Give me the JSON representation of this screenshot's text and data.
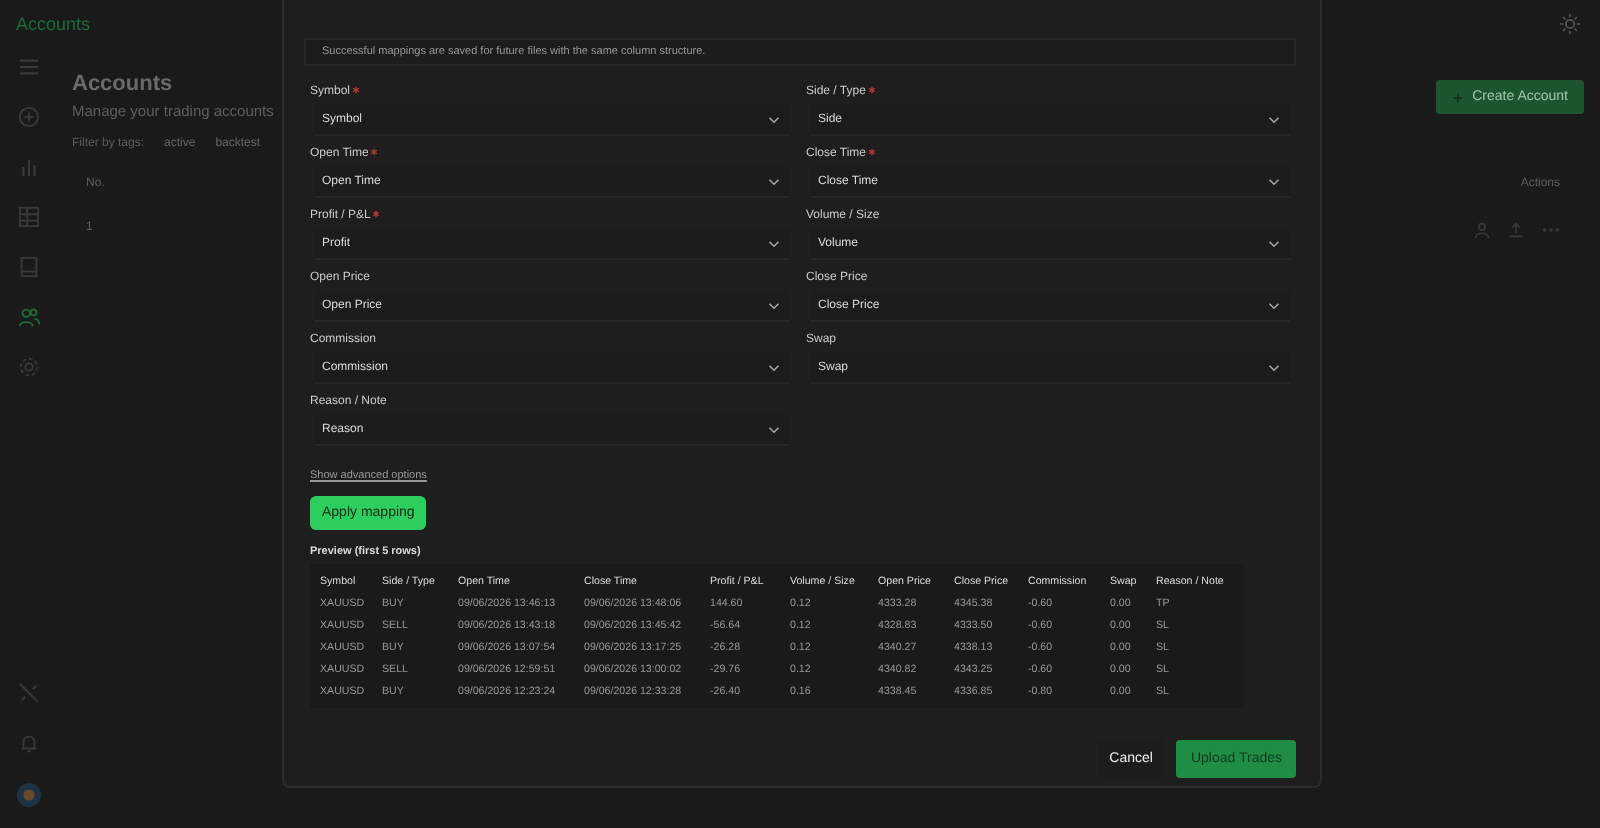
{
  "app": {
    "title": "Accounts"
  },
  "sidebar": {
    "items": [
      {
        "kind": "menu",
        "selected": false
      },
      {
        "kind": "add",
        "selected": false
      },
      {
        "kind": "chart",
        "selected": false
      },
      {
        "kind": "table",
        "selected": false
      },
      {
        "kind": "journal",
        "selected": false
      },
      {
        "kind": "accounts",
        "selected": true
      },
      {
        "kind": "settings",
        "selected": false
      }
    ],
    "bottom": [
      {
        "kind": "plug"
      },
      {
        "kind": "bell"
      },
      {
        "kind": "avatar"
      }
    ]
  },
  "page": {
    "title": "Accounts",
    "subtitle": "Manage your trading accounts",
    "filter_label": "Filter by tags:",
    "tags": [
      "active",
      "backtest"
    ],
    "create_button": "Create Account",
    "columns": [
      "No.",
      "Actions"
    ],
    "rows": [
      {
        "no": "1"
      }
    ]
  },
  "modal": {
    "note": "Successful mappings are saved for future files with the same column structure.",
    "fields": [
      {
        "label": "Symbol",
        "required": true,
        "value": "Symbol"
      },
      {
        "label": "Side / Type",
        "required": true,
        "value": "Side"
      },
      {
        "label": "Open Time",
        "required": true,
        "value": "Open Time"
      },
      {
        "label": "Close Time",
        "required": true,
        "value": "Close Time"
      },
      {
        "label": "Profit / P&L",
        "required": true,
        "value": "Profit"
      },
      {
        "label": "Volume / Size",
        "required": false,
        "value": "Volume"
      },
      {
        "label": "Open Price",
        "required": false,
        "value": "Open Price"
      },
      {
        "label": "Close Price",
        "required": false,
        "value": "Close Price"
      },
      {
        "label": "Commission",
        "required": false,
        "value": "Commission"
      },
      {
        "label": "Swap",
        "required": false,
        "value": "Swap"
      },
      {
        "label": "Reason / Note",
        "required": false,
        "value": "Reason"
      }
    ],
    "advanced_link": "Show advanced options",
    "apply_button": "Apply mapping",
    "preview": {
      "title": "Preview (first 5 rows)",
      "columns": [
        "Symbol",
        "Side / Type",
        "Open Time",
        "Close Time",
        "Profit / P&L",
        "Volume / Size",
        "Open Price",
        "Close Price",
        "Commission",
        "Swap",
        "Reason / Note"
      ],
      "rows": [
        [
          "XAUUSD",
          "BUY",
          "09/06/2026 13:46:13",
          "09/06/2026 13:48:06",
          "144.60",
          "0.12",
          "4333.28",
          "4345.38",
          "-0.60",
          "0.00",
          "TP"
        ],
        [
          "XAUUSD",
          "SELL",
          "09/06/2026 13:43:18",
          "09/06/2026 13:45:42",
          "-56.64",
          "0.12",
          "4328.83",
          "4333.50",
          "-0.60",
          "0.00",
          "SL"
        ],
        [
          "XAUUSD",
          "BUY",
          "09/06/2026 13:07:54",
          "09/06/2026 13:17:25",
          "-26.28",
          "0.12",
          "4340.27",
          "4338.13",
          "-0.60",
          "0.00",
          "SL"
        ],
        [
          "XAUUSD",
          "SELL",
          "09/06/2026 12:59:51",
          "09/06/2026 13:00:02",
          "-29.76",
          "0.12",
          "4340.82",
          "4343.25",
          "-0.60",
          "0.00",
          "SL"
        ],
        [
          "XAUUSD",
          "BUY",
          "09/06/2026 12:23:24",
          "09/06/2026 12:33:28",
          "-26.40",
          "0.16",
          "4338.45",
          "4336.85",
          "-0.80",
          "0.00",
          "SL"
        ]
      ]
    },
    "cancel_button": "Cancel",
    "upload_button": "Upload Trades"
  }
}
